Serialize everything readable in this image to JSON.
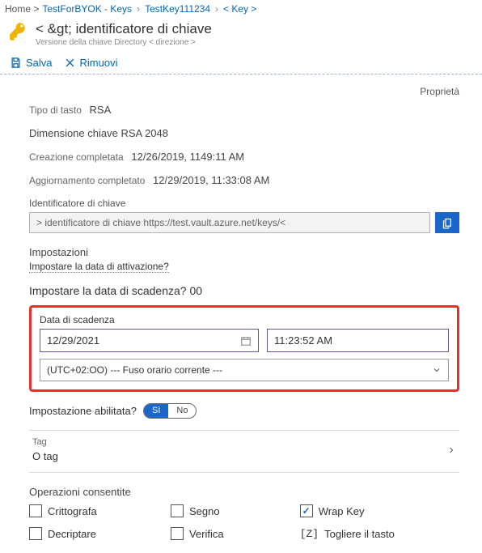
{
  "breadcrumb": {
    "home": "Home >",
    "item1": "TestForBYOK - Keys",
    "item2": "TestKey111234",
    "item3": "< Key >"
  },
  "header": {
    "title": "< &gt; identificatore di chiave",
    "sub": "Versione della chiave   Directory < direzione >"
  },
  "toolbar": {
    "save": "Salva",
    "remove": "Rimuovi"
  },
  "props": {
    "right": "Proprietà",
    "type_label": "Tipo di tasto",
    "type_value": "RSA",
    "size": "Dimensione chiave RSA 2048",
    "created_label": "Creazione completata",
    "created_value": "12/26/2019, 1149:11 AM",
    "updated_label": "Aggiornamento completato",
    "updated_value": "12/29/2019, 11:33:08 AM",
    "kid_label": "Identificatore di chiave",
    "kid_value": "> identificatore di chiave https://test.vault.azure.net/keys/<"
  },
  "settings": {
    "label": "Impostazioni",
    "activation_q": "Impostare la data di attivazione?",
    "expiration_q": "Impostare la data di scadenza? 00",
    "callout_label": "Data di scadenza",
    "date": "12/29/2021",
    "time": "11:23:52 AM",
    "tz": "(UTC+02:OO) --- Fuso orario corrente ---",
    "enabled_label": "Impostazione abilitata?",
    "yes": "Sì",
    "no": "No"
  },
  "tags": {
    "label": "Tag",
    "value": "O tag"
  },
  "ops": {
    "label": "Operazioni consentite",
    "encrypt": "Crittografa",
    "sign": "Segno",
    "wrap": "Wrap Key",
    "decrypt": "Decriptare",
    "verify": "Verifica",
    "unwrap_prefix": "[Z]",
    "unwrap": "Togliere il tasto"
  }
}
